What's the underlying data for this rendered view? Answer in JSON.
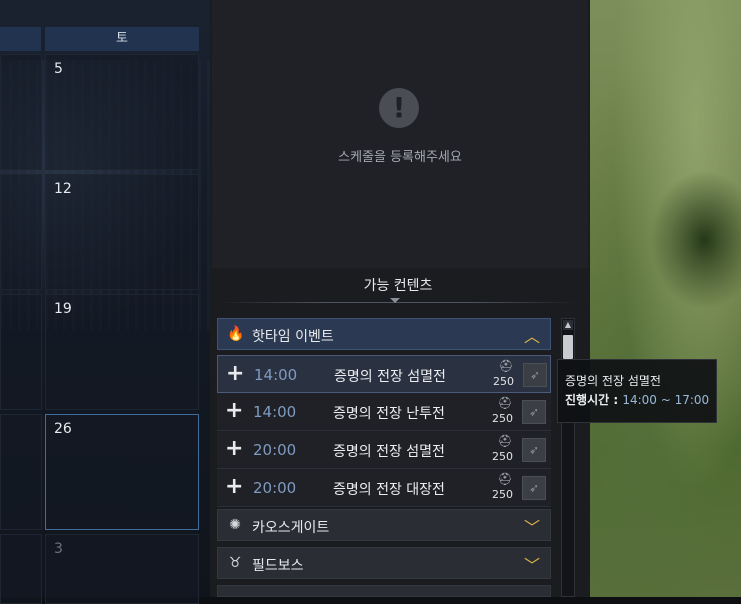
{
  "calendar": {
    "header_sat": "토",
    "days": [
      "5",
      "12",
      "19",
      "26",
      "3"
    ]
  },
  "schedule": {
    "empty_message": "스케줄을 등록해주세요",
    "warn_symbol": "!"
  },
  "contents": {
    "title": "가능 컨텐츠",
    "categories": [
      {
        "label": "핫타임 이벤트",
        "icon": "flame-icon",
        "expanded": true
      },
      {
        "label": "카오스게이트",
        "icon": "chaos-gate-icon",
        "expanded": false
      },
      {
        "label": "필드보스",
        "icon": "field-boss-icon",
        "expanded": false
      }
    ],
    "rows": [
      {
        "time": "14:00",
        "name": "증명의 전장 섬멸전",
        "gear_score": "250"
      },
      {
        "time": "14:00",
        "name": "증명의 전장 난투전",
        "gear_score": "250"
      },
      {
        "time": "20:00",
        "name": "증명의 전장 섬멸전",
        "gear_score": "250"
      },
      {
        "time": "20:00",
        "name": "증명의 전장 대장전",
        "gear_score": "250"
      }
    ]
  },
  "tooltip": {
    "name": "증명의 전장 섬멸전",
    "time_label": "진행시간 : ",
    "time_value": "14:00 ~ 17:00"
  },
  "colors": {
    "accent": "#e3b84a",
    "time": "#7f9bc0"
  }
}
